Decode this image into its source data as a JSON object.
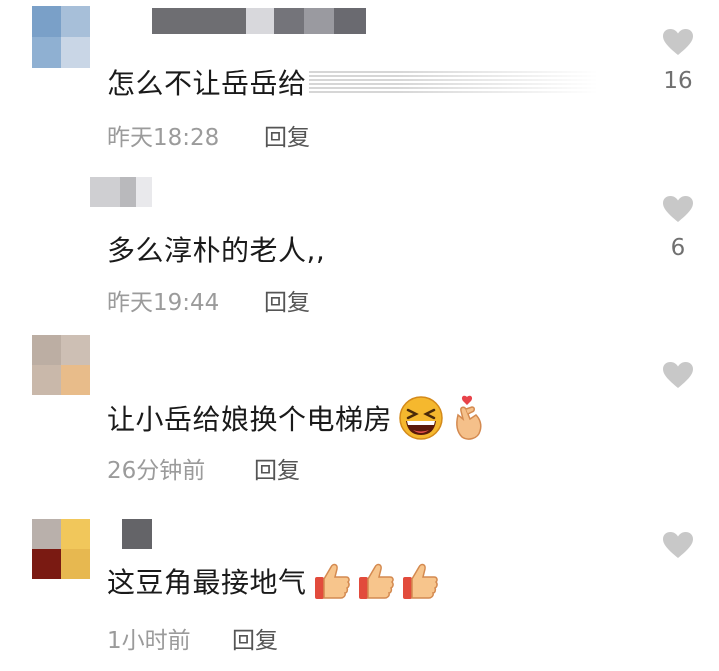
{
  "comments": [
    {
      "text": "怎么不让岳岳给",
      "time": "昨天18:28",
      "reply": "回复",
      "likes": "16",
      "avatar_colors": [
        "#7aa0c8",
        "#a7bfd9",
        "#8fb0d2",
        "#c9d6e6"
      ]
    },
    {
      "text": "多么淳朴的老人,,",
      "time": "昨天19:44",
      "reply": "回复",
      "likes": "6",
      "avatar_colors": []
    },
    {
      "text": "让小岳给娘换个电梯房",
      "time": "26分钟前",
      "reply": "回复",
      "likes": "",
      "avatar_colors": [
        "#bcaea3",
        "#cdbfb4",
        "#c9b8aa",
        "#e8bc8a"
      ]
    },
    {
      "text": "这豆角最接地气",
      "time": "1小时前",
      "reply": "回复",
      "likes": "",
      "avatar_colors": [
        "#b9b0ab",
        "#f1c75b",
        "#7a1a12",
        "#e7b850"
      ]
    }
  ],
  "icons": {
    "like": "heart-icon",
    "laugh": "grinning-squinting-face-icon",
    "finger_heart": "finger-heart-icon",
    "thumbs": "thumbs-up-icon"
  },
  "colors": {
    "like_heart": "#c8c8c8",
    "meta": "#9b9b9b",
    "text": "#1a1a1a"
  }
}
